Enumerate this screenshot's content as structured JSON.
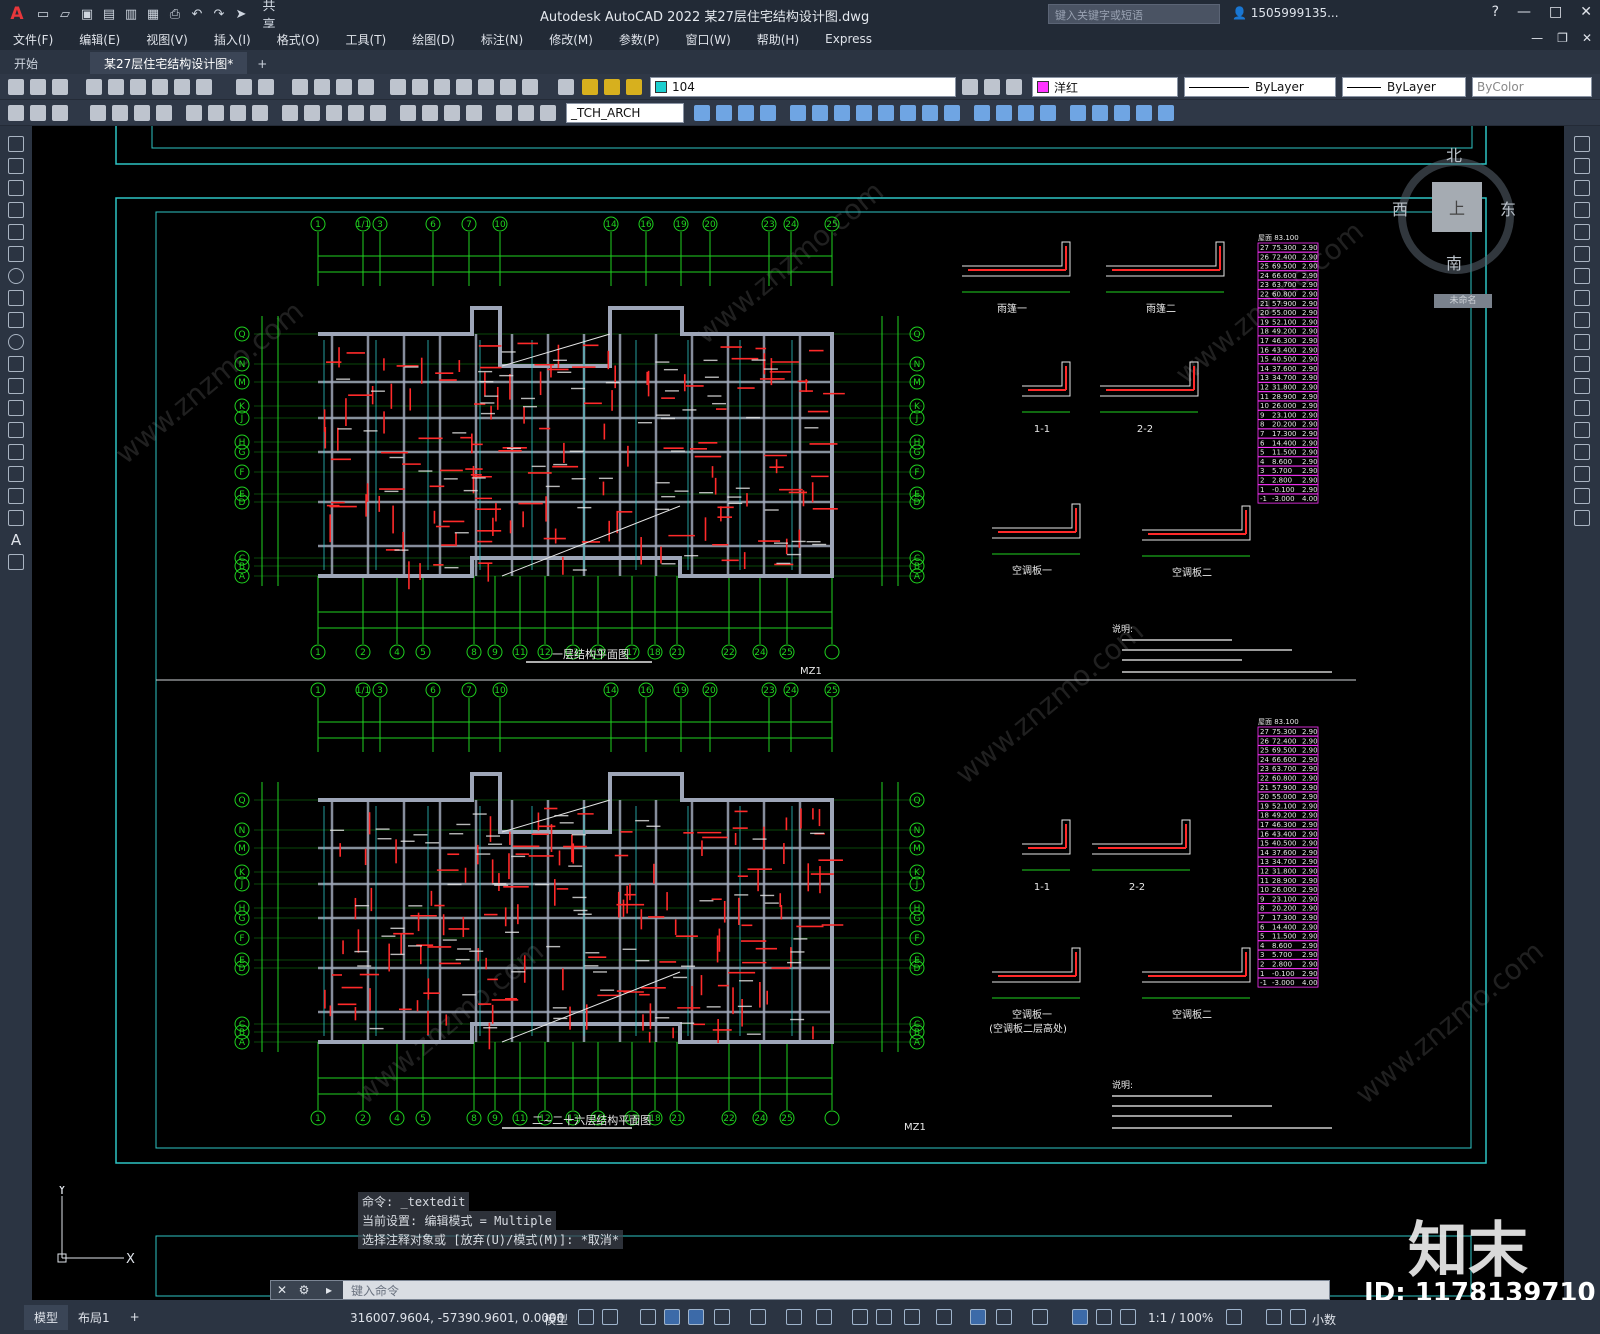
{
  "app": {
    "title": "Autodesk AutoCAD 2022    某27层住宅结构设计图.dwg",
    "share_label": "共享",
    "search_placeholder": "键入关键字或短语",
    "user": "1505999135..."
  },
  "menu": [
    "文件(F)",
    "编辑(E)",
    "视图(V)",
    "插入(I)",
    "格式(O)",
    "工具(T)",
    "绘图(D)",
    "标注(N)",
    "修改(M)",
    "参数(P)",
    "窗口(W)",
    "帮助(H)",
    "Express"
  ],
  "doc_tabs": [
    {
      "label": "开始"
    },
    {
      "label": "某27层住宅结构设计图*"
    }
  ],
  "toolbar": {
    "layer": "104",
    "color_name": "洋红",
    "linetype": "ByLayer",
    "lineweight": "ByLayer",
    "plotstyle": "ByColor",
    "textstyle": "_TCH_ARCH"
  },
  "viewcube": {
    "north": "北",
    "south": "南",
    "east": "东",
    "west": "西",
    "face": "上",
    "wcs": "未命名"
  },
  "drawing": {
    "plan1_title": "一层结构平面图",
    "plan2_title": "二~二十六层结构平面图",
    "grid_top": [
      "1",
      "1/1",
      "3",
      "6",
      "7",
      "10",
      "14",
      "16",
      "19",
      "20",
      "23",
      "24",
      "25"
    ],
    "grid_bottom": [
      "1",
      "2",
      "4",
      "5",
      "8",
      "9",
      "11",
      "12",
      "13",
      "15",
      "17",
      "18",
      "21",
      "22",
      "24",
      "25"
    ],
    "grid_left": [
      "Q",
      "N",
      "M",
      "K",
      "J",
      "H",
      "G",
      "F",
      "E",
      "D",
      "C",
      "B",
      "A"
    ],
    "sections": [
      "雨篷一",
      "雨篷二",
      "1-1",
      "2-2",
      "空调板一",
      "空调板二"
    ],
    "sections_lower": [
      "1-1",
      "2-2",
      "空调板一",
      "(空调板二层高处)",
      "空调板二"
    ],
    "notes_title": "说明:",
    "mz": "MZ1",
    "elev_header": "屋面  83.100",
    "elevations": [
      [
        "27",
        "75.300",
        "2.90"
      ],
      [
        "26",
        "72.400",
        "2.90"
      ],
      [
        "25",
        "69.500",
        "2.90"
      ],
      [
        "24",
        "66.600",
        "2.90"
      ],
      [
        "23",
        "63.700",
        "2.90"
      ],
      [
        "22",
        "60.800",
        "2.90"
      ],
      [
        "21",
        "57.900",
        "2.90"
      ],
      [
        "20",
        "55.000",
        "2.90"
      ],
      [
        "19",
        "52.100",
        "2.90"
      ],
      [
        "18",
        "49.200",
        "2.90"
      ],
      [
        "17",
        "46.300",
        "2.90"
      ],
      [
        "16",
        "43.400",
        "2.90"
      ],
      [
        "15",
        "40.500",
        "2.90"
      ],
      [
        "14",
        "37.600",
        "2.90"
      ],
      [
        "13",
        "34.700",
        "2.90"
      ],
      [
        "12",
        "31.800",
        "2.90"
      ],
      [
        "11",
        "28.900",
        "2.90"
      ],
      [
        "10",
        "26.000",
        "2.90"
      ],
      [
        "9",
        "23.100",
        "2.90"
      ],
      [
        "8",
        "20.200",
        "2.90"
      ],
      [
        "7",
        "17.300",
        "2.90"
      ],
      [
        "6",
        "14.400",
        "2.90"
      ],
      [
        "5",
        "11.500",
        "2.90"
      ],
      [
        "4",
        "8.600",
        "2.90"
      ],
      [
        "3",
        "5.700",
        "2.90"
      ],
      [
        "2",
        "2.800",
        "2.90"
      ],
      [
        "1",
        "-0.100",
        "2.90"
      ],
      [
        "-1",
        "-3.000",
        "4.00"
      ]
    ]
  },
  "command": {
    "history": [
      "命令: _textedit",
      "当前设置: 编辑模式 = Multiple",
      "选择注释对象或 [放弃(U)/模式(M)]: *取消*"
    ],
    "prompt": "键入命令"
  },
  "status": {
    "tabs": [
      "模型",
      "布局1"
    ],
    "coords": "316007.9604, -57390.9601, 0.0000",
    "space": "模型",
    "scale": "1:1 / 100%",
    "units": "小数"
  },
  "watermark": {
    "brand": "知末",
    "id": "ID: 1178139710",
    "site": "www.znzmo.com"
  },
  "colors": {
    "accent_cyan": "#2ec4c4",
    "grid_green": "#1fd21f",
    "rebar_red": "#ff2a2a",
    "magenta": "#ff33ff",
    "wall_gray": "#9ea6b8"
  }
}
